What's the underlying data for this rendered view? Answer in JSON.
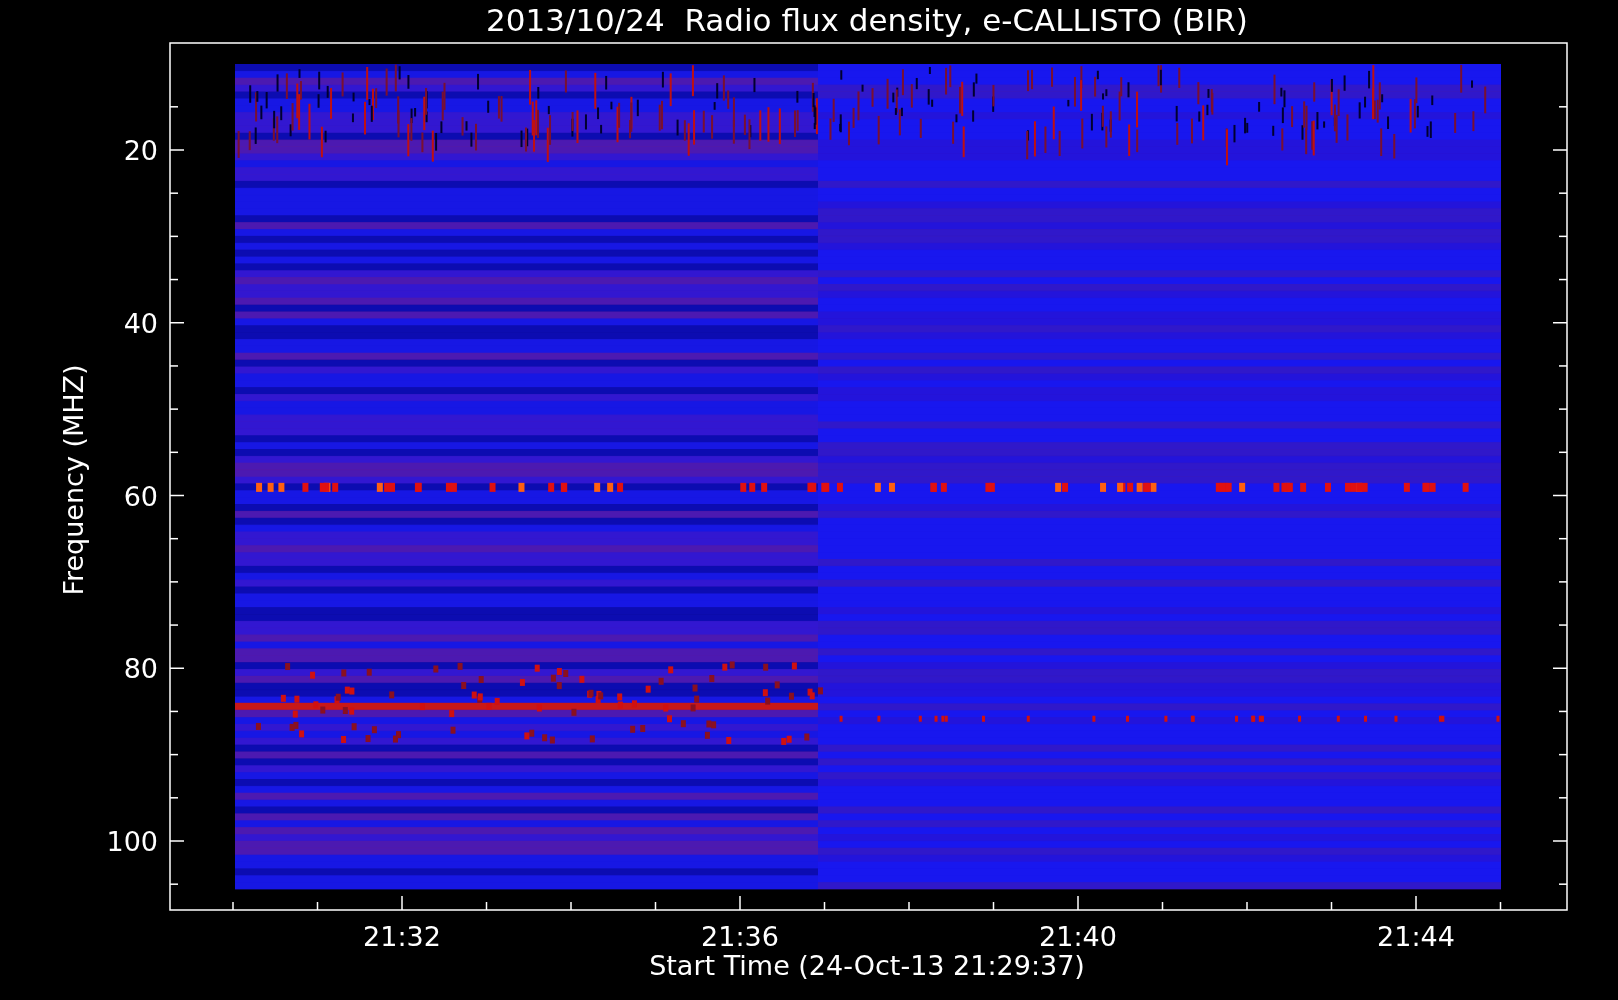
{
  "title": "2013/10/24  Radio flux density, e-CALLISTO (BIR)",
  "plot": {
    "y_axis": {
      "label": "Frequency (MHZ)",
      "ticks": [
        "20",
        "40",
        "60",
        "80",
        "100"
      ]
    },
    "x_axis": {
      "label": "Start Time (24-Oct-13 21:29:37)",
      "ticks": [
        "21:32",
        "21:36",
        "21:40",
        "21:44"
      ]
    }
  }
}
